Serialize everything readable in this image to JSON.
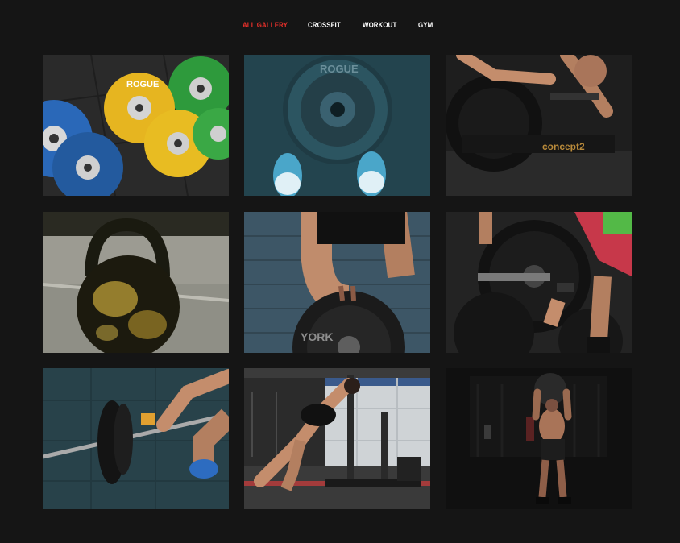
{
  "filters": [
    {
      "label": "ALL GALLERY",
      "active": true
    },
    {
      "label": "CROSSFIT",
      "active": false
    },
    {
      "label": "WORKOUT",
      "active": false
    },
    {
      "label": "GYM",
      "active": false
    }
  ],
  "gallery": {
    "items": [
      {
        "subject": "rogue-bumper-plates",
        "plate_brand": "ROGUE"
      },
      {
        "subject": "rogue-plate-feet",
        "plate_brand": "ROGUE"
      },
      {
        "subject": "rowing-machine",
        "machine_brand": "concept2"
      },
      {
        "subject": "kettlebell"
      },
      {
        "subject": "york-plate-athlete",
        "plate_brand": "YORK"
      },
      {
        "subject": "loading-barbell-plates"
      },
      {
        "subject": "barbell-lift"
      },
      {
        "subject": "sled-push"
      },
      {
        "subject": "medicine-ball-athlete"
      }
    ]
  },
  "colors": {
    "background": "#151515",
    "accent": "#e8302a",
    "nav_text": "#ffffff"
  }
}
